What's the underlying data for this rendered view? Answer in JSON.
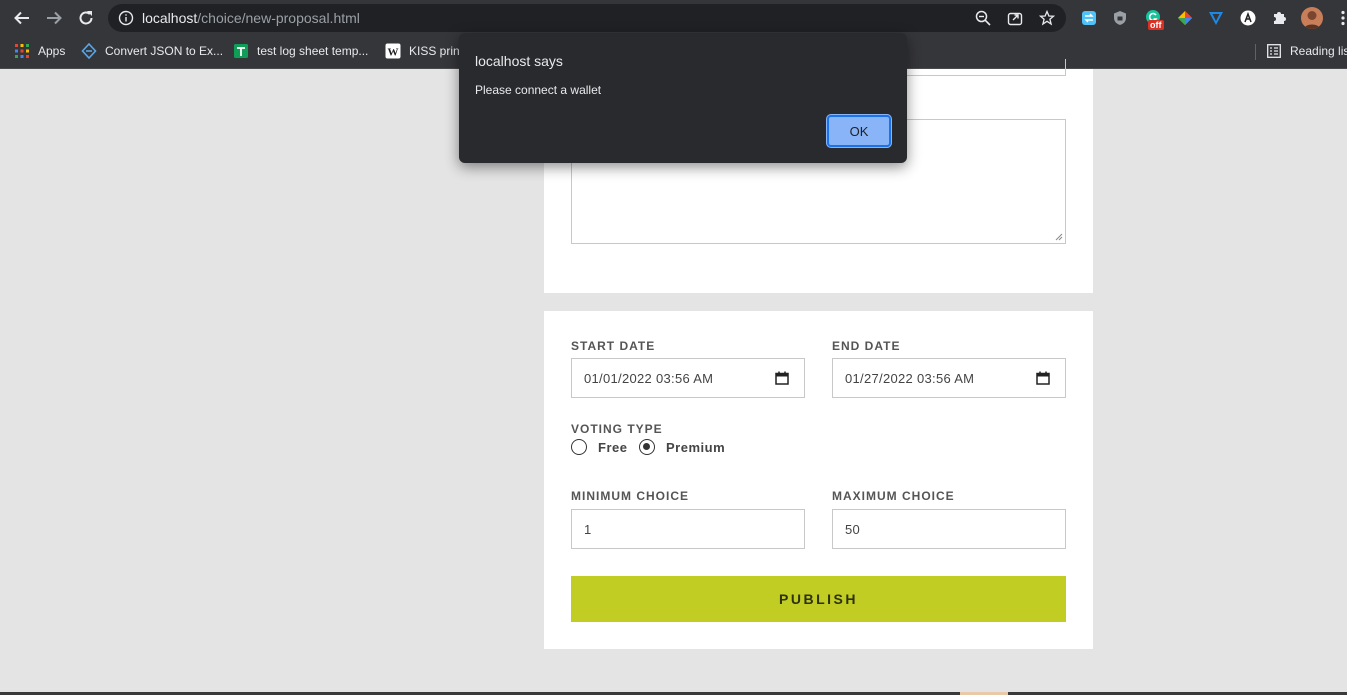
{
  "browser": {
    "url_host": "localhost",
    "url_path": "/choice/new-proposal.html",
    "extensions": [
      {
        "name": "sync-icon",
        "color": "#4fc3f7"
      },
      {
        "name": "shield-icon",
        "color": "#9aa0a6"
      },
      {
        "name": "grammarly-icon",
        "color": "#15c39a",
        "badge": "off"
      },
      {
        "name": "colorpicker-icon",
        "color": "#ea4335"
      },
      {
        "name": "vpn-icon",
        "color": "#1e88e5"
      },
      {
        "name": "arc-icon",
        "color": "#ffffff"
      },
      {
        "name": "puzzle-icon",
        "color": "#e8eaed"
      }
    ]
  },
  "bookmarks": {
    "apps": "Apps",
    "items": [
      {
        "label": "Convert JSON to Ex..."
      },
      {
        "label": "test log sheet temp..."
      },
      {
        "label": "KISS princ"
      }
    ],
    "reading_list": "Reading lis"
  },
  "form": {
    "start_date_label": "START DATE",
    "start_date_value": "01/01/2022 03:56 AM",
    "end_date_label": "END DATE",
    "end_date_value": "01/27/2022 03:56 AM",
    "voting_type_label": "VOTING TYPE",
    "voting_options": [
      {
        "label": "Free",
        "checked": false
      },
      {
        "label": "Premium",
        "checked": true
      }
    ],
    "min_choice_label": "MINIMUM CHOICE",
    "min_choice_value": "1",
    "max_choice_label": "MAXIMUM CHOICE",
    "max_choice_value": "50",
    "publish_label": "PUBLISH"
  },
  "dialog": {
    "title": "localhost says",
    "message": "Please connect a wallet",
    "ok_label": "OK"
  },
  "colors": {
    "accent": "#c2cd23",
    "page_bg": "#e4e4e4",
    "chrome_bg": "#35363a",
    "dialog_bg": "#292a2d",
    "ok_button": "#8ab4f8"
  }
}
